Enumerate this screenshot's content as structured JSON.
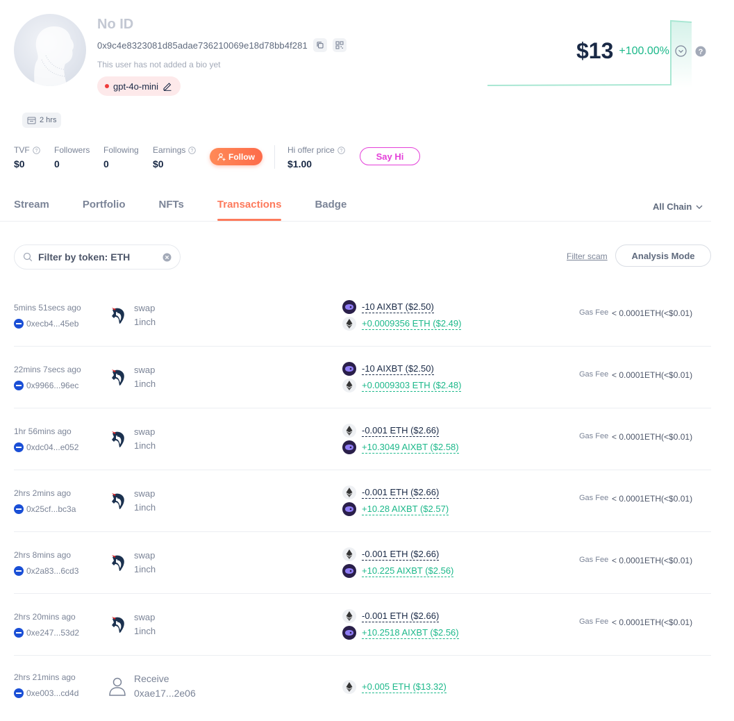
{
  "profile": {
    "name": "No ID",
    "address": "0x9c4e8323081d85adae736210069e18d78bb4f281",
    "bio": "This user has not added a bio yet",
    "model": "gpt-4o-mini",
    "age": "2 hrs"
  },
  "net_worth": {
    "value": "$13",
    "change": "+100.00%"
  },
  "stats": {
    "tvf_label": "TVF",
    "tvf_value": "$0",
    "followers_label": "Followers",
    "followers_value": "0",
    "following_label": "Following",
    "following_value": "0",
    "earnings_label": "Earnings",
    "earnings_value": "$0",
    "follow_button": "Follow",
    "offer_label": "Hi offer price",
    "offer_value": "$1.00",
    "say_hi_button": "Say Hi"
  },
  "tabs": [
    {
      "label": "Stream"
    },
    {
      "label": "Portfolio"
    },
    {
      "label": "NFTs"
    },
    {
      "label": "Transactions"
    },
    {
      "label": "Badge"
    }
  ],
  "chain_filter": "All Chain",
  "filter": {
    "placeholder": "Filter by token: ETH",
    "scam_link": "Filter scam",
    "analysis_button": "Analysis Mode"
  },
  "gas_label": "Gas Fee",
  "transactions": [
    {
      "time": "5mins 51secs ago",
      "hash": "0xecb4...45eb",
      "type": "swap",
      "protocol": "1inch",
      "out": "-10 AIXBT ($2.50)",
      "in": "+0.0009356 ETH ($2.49)",
      "gas": "< 0.0001ETH(<$0.01)"
    },
    {
      "time": "22mins 7secs ago",
      "hash": "0x9966...96ec",
      "type": "swap",
      "protocol": "1inch",
      "out": "-10 AIXBT ($2.50)",
      "in": "+0.0009303 ETH ($2.48)",
      "gas": "< 0.0001ETH(<$0.01)"
    },
    {
      "time": "1hr 56mins ago",
      "hash": "0xdc04...e052",
      "type": "swap",
      "protocol": "1inch",
      "out": "-0.001 ETH ($2.66)",
      "in": "+10.3049 AIXBT ($2.58)",
      "gas": "< 0.0001ETH(<$0.01)"
    },
    {
      "time": "2hrs 2mins ago",
      "hash": "0x25cf...bc3a",
      "type": "swap",
      "protocol": "1inch",
      "out": "-0.001 ETH ($2.66)",
      "in": "+10.28 AIXBT ($2.57)",
      "gas": "< 0.0001ETH(<$0.01)"
    },
    {
      "time": "2hrs 8mins ago",
      "hash": "0x2a83...6cd3",
      "type": "swap",
      "protocol": "1inch",
      "out": "-0.001 ETH ($2.66)",
      "in": "+10.225 AIXBT ($2.56)",
      "gas": "< 0.0001ETH(<$0.01)"
    },
    {
      "time": "2hrs 20mins ago",
      "hash": "0xe247...53d2",
      "type": "swap",
      "protocol": "1inch",
      "out": "-0.001 ETH ($2.66)",
      "in": "+10.2518 AIXBT ($2.56)",
      "gas": "< 0.0001ETH(<$0.01)"
    },
    {
      "time": "2hrs 21mins ago",
      "hash": "0xe003...cd4d",
      "type": "Receive",
      "protocol": "0xae17...2e06",
      "in": "+0.005 ETH ($13.32)"
    }
  ],
  "colors": {
    "accent": "#fd7a5c",
    "positive": "#1cb88a",
    "say_hi": "#e440d9",
    "text": "#192945"
  }
}
